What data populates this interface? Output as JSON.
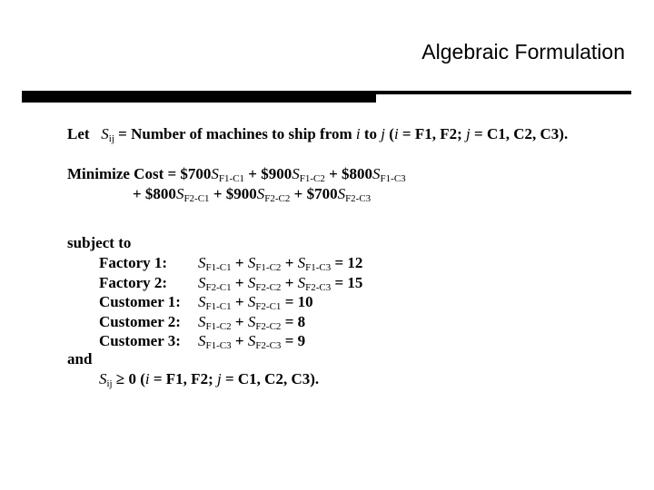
{
  "slide": {
    "title": "Algebraic Formulation"
  },
  "definition": {
    "lead": "Let",
    "var": "S",
    "var_sub": "ij",
    "text_1": " = Number of machines to ship from ",
    "i": "i",
    "text_2": " to ",
    "j": "j",
    "text_3": " (",
    "i2": "i",
    "text_4": " = F1, F2;  ",
    "j2": "j",
    "text_5": " = C1, C2, C3)."
  },
  "objective": {
    "label": "Minimize Cost = ",
    "line1_terms": [
      {
        "prefix": "$700",
        "sub": "F1-C1",
        "suffix": " + "
      },
      {
        "prefix": "$900",
        "sub": "F1-C2",
        "suffix": " + "
      },
      {
        "prefix": "$800",
        "sub": "F1-C3",
        "suffix": ""
      }
    ],
    "line2_terms": [
      {
        "prefix": "+ $800",
        "sub": "F2-C1",
        "suffix": " + "
      },
      {
        "prefix": "$900",
        "sub": "F2-C2",
        "suffix": " + "
      },
      {
        "prefix": "$700",
        "sub": "F2-C3",
        "suffix": ""
      }
    ],
    "var": "S"
  },
  "constraints": {
    "heading": "subject to",
    "rows": [
      {
        "label": "Factory 1:",
        "subs": [
          "F1-C1",
          "F1-C2",
          "F1-C3"
        ],
        "rhs": " = 12"
      },
      {
        "label": "Factory 2:",
        "subs": [
          "F2-C1",
          "F2-C2",
          "F2-C3"
        ],
        "rhs": " = 15"
      },
      {
        "label": "Customer 1:",
        "subs": [
          "F1-C1",
          "F2-C1"
        ],
        "rhs": " = 10"
      },
      {
        "label": "Customer 2:",
        "subs": [
          "F1-C2",
          "F2-C2"
        ],
        "rhs": " = 8"
      },
      {
        "label": "Customer 3:",
        "subs": [
          "F1-C3",
          "F2-C3"
        ],
        "rhs": " = 9"
      }
    ],
    "and_label": "and",
    "nonneg": {
      "var": "S",
      "var_sub": "ij",
      "text_1": " ≥ 0 (",
      "i": "i",
      "text_2": " = F1, F2;  ",
      "j": "j",
      "text_3": " = C1, C2, C3)."
    }
  }
}
